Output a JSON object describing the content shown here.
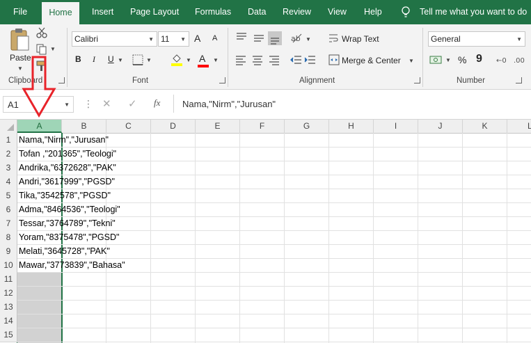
{
  "tabs": [
    "File",
    "Home",
    "Insert",
    "Page Layout",
    "Formulas",
    "Data",
    "Review",
    "View",
    "Help"
  ],
  "tell_me": "Tell me what you want to do",
  "clipboard": {
    "paste_label": "Paste",
    "group_label": "Clipboard"
  },
  "font": {
    "name": "Calibri",
    "size": "11",
    "group_label": "Font",
    "bold": "B",
    "italic": "I",
    "underline": "U",
    "grow": "A",
    "shrink": "A",
    "font_color_letter": "A"
  },
  "alignment": {
    "wrap_text": "Wrap Text",
    "merge_center": "Merge & Center",
    "group_label": "Alignment"
  },
  "number": {
    "format": "General",
    "percent": "%",
    "comma": "9",
    "group_label": "Number"
  },
  "formula_bar": {
    "name_box": "A1",
    "fx": "fx",
    "formula": "Nama,\"Nirm\",\"Jurusan\""
  },
  "colors": {
    "excel_green": "#217346",
    "selected_col": "#d2d2d2",
    "selected_hdr": "#9fd5b7",
    "arrow_red": "#e8232a",
    "fill_yellow": "#ffff00",
    "font_red": "#ff0000"
  },
  "columns": [
    "A",
    "B",
    "C",
    "D",
    "E",
    "F",
    "G",
    "H",
    "I",
    "J",
    "K",
    "L"
  ],
  "rows": [
    "1",
    "2",
    "3",
    "4",
    "5",
    "6",
    "7",
    "8",
    "9",
    "10",
    "11",
    "12",
    "13",
    "14",
    "15"
  ],
  "cells": [
    "Nama,\"Nirm\",\"Jurusan\"",
    "Tofan ,\"201365\",\"Teologi\"",
    "Andrika,\"6372628\",\"PAK\"",
    "Andri,\"3617999\",\"PGSD\"",
    "Tika,\"3542578\",\"PGSD\"",
    "Adma,\"8464536\",\"Teologi\"",
    "Tessar,\"3764789\",\"Tekni\"",
    "Yoram,\"8375478\",\"PGSD\"",
    "Melati,\"3645728\",\"PAK\"",
    "Mawar,\"3773839\",\"Bahasa\""
  ],
  "annotation": {
    "icon": "down-arrow-icon"
  }
}
